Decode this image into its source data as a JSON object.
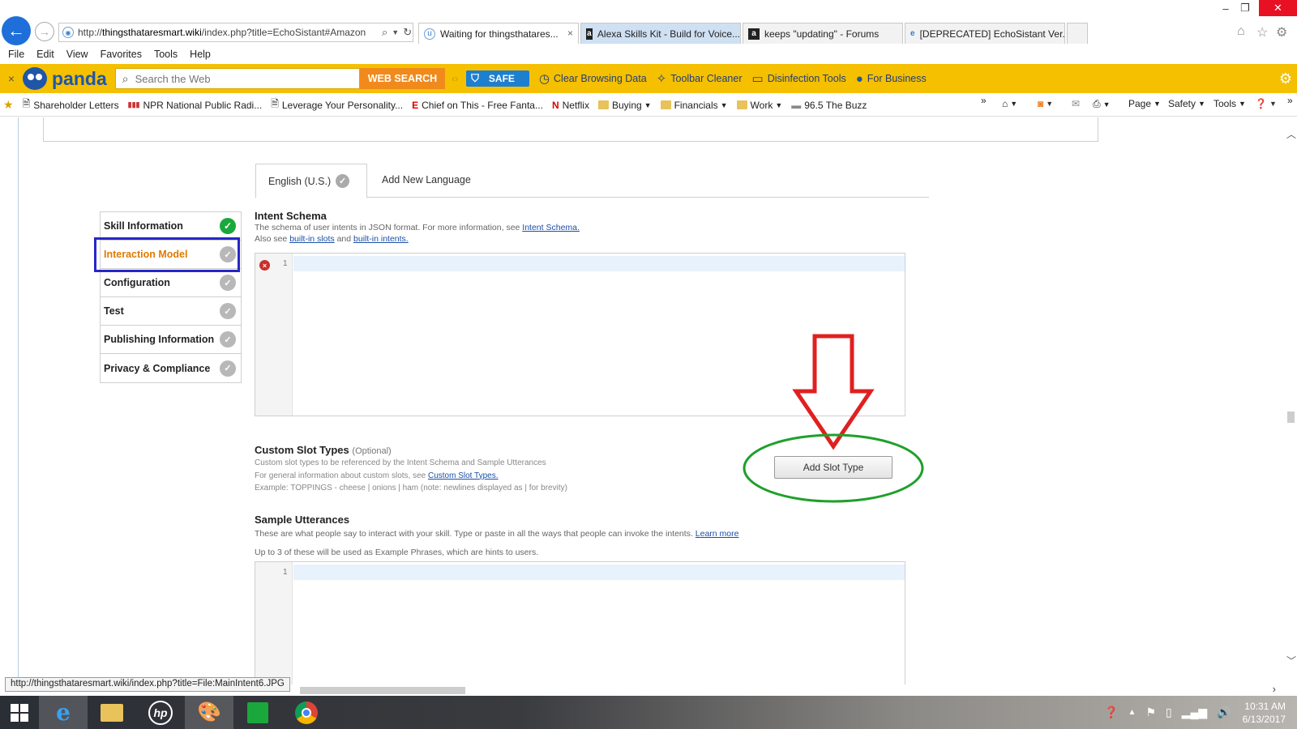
{
  "browser": {
    "back_icon": "←",
    "forward_icon": "→",
    "url_prefix": "http://",
    "url_domain": "thingsthataresmart.wiki",
    "url_rest": "/index.php?title=EchoSistant#Amazon",
    "tabs": [
      {
        "label": "Waiting for thingsthatares...",
        "close": "×"
      },
      {
        "label": "Alexa Skills Kit - Build for Voice..."
      },
      {
        "label": "keeps \"updating\" - Forums"
      },
      {
        "label": "[DEPRECATED] EchoSistant Ver..."
      }
    ]
  },
  "menu": [
    "File",
    "Edit",
    "View",
    "Favorites",
    "Tools",
    "Help"
  ],
  "panda_toolbar": {
    "close": "×",
    "brand": "panda",
    "search_placeholder": "Search the Web",
    "search_button": "WEB SEARCH",
    "safe_label": "SAFE",
    "items": [
      "Clear Browsing Data",
      "Toolbar Cleaner",
      "Disinfection Tools",
      "For Business"
    ]
  },
  "favorites": {
    "items": [
      {
        "label": "Shareholder Letters"
      },
      {
        "label": "NPR  National Public Radi..."
      },
      {
        "label": "Leverage Your Personality..."
      },
      {
        "label": "Chief on This - Free Fanta..."
      },
      {
        "label": "Netflix"
      },
      {
        "label": "Buying"
      },
      {
        "label": "Financials"
      },
      {
        "label": "Work"
      },
      {
        "label": "96.5 The Buzz"
      }
    ],
    "commands": [
      "Page",
      "Safety",
      "Tools"
    ]
  },
  "page": {
    "language_tab": "English (U.S.)",
    "add_language": "Add New Language",
    "steps": [
      {
        "label": "Skill Information",
        "status": "complete"
      },
      {
        "label": "Interaction Model",
        "status": "current"
      },
      {
        "label": "Configuration",
        "status": "pending"
      },
      {
        "label": "Test",
        "status": "pending"
      },
      {
        "label": "Publishing Information",
        "status": "pending"
      },
      {
        "label": "Privacy & Compliance",
        "status": "pending"
      }
    ],
    "intent_schema": {
      "title": "Intent Schema",
      "desc_1": "The schema of user intents in JSON format. For more information, see ",
      "link_1": "Intent Schema.",
      "desc_2a": "Also see ",
      "link_2": "built-in slots",
      "desc_2b": " and ",
      "link_3": "built-in intents.",
      "line_number": "1"
    },
    "custom_slots": {
      "title": "Custom Slot Types",
      "optional": "(Optional)",
      "desc_1": "Custom slot types to be referenced by the Intent Schema and Sample Utterances",
      "desc_2": "For general information about custom slots, see ",
      "link": "Custom Slot Types.",
      "desc_3": "Example: TOPPINGS - cheese | onions | ham (note: newlines displayed as | for brevity)",
      "button": "Add Slot Type"
    },
    "sample_utterances": {
      "title": "Sample Utterances",
      "desc_1": "These are what people say to interact with your skill. Type or paste in all the ways that people can invoke the intents. ",
      "link": "Learn more",
      "desc_2": "Up to 3 of these will be used as Example Phrases, which are hints to users.",
      "line_number": "1"
    }
  },
  "status_url": "http://thingsthataresmart.wiki/index.php?title=File:MainIntent6.JPG",
  "taskbar": {
    "time": "10:31 AM",
    "date": "6/13/2017"
  },
  "colors": {
    "highlight_box": "#2626c9",
    "arrow": "#e02020",
    "ellipse": "#1fa02b",
    "panda_bar": "#f5c000",
    "current_step": "#e07b00"
  }
}
